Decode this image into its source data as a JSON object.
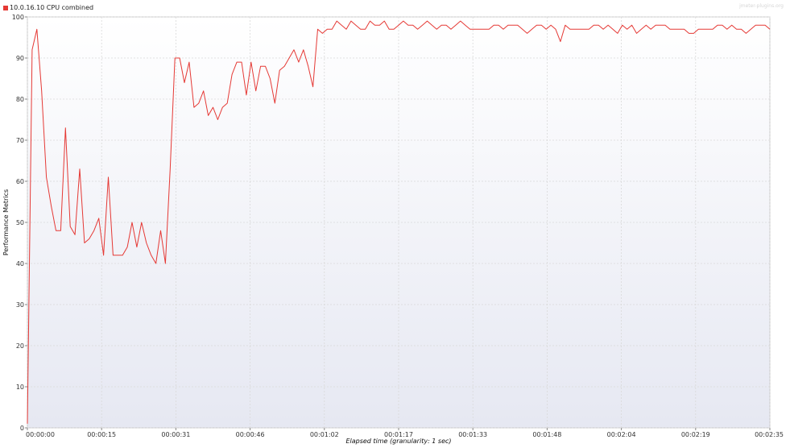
{
  "legend": {
    "label": "10.0.16.10 CPU combined",
    "color": "#e53935"
  },
  "watermark": "jmeter-plugins.org",
  "chart_data": {
    "type": "line",
    "title": "",
    "xlabel": "Elapsed time (granularity: 1 sec)",
    "ylabel": "Performance Metrics",
    "ylim": [
      0,
      100
    ],
    "xlim": [
      0,
      155
    ],
    "grid": true,
    "legend_position": "top-left",
    "y_ticks": [
      0,
      10,
      20,
      30,
      40,
      50,
      60,
      70,
      80,
      90,
      100
    ],
    "x_ticks": [
      {
        "t": 0,
        "label": "00:00:00"
      },
      {
        "t": 15.5,
        "label": "00:00:15"
      },
      {
        "t": 31,
        "label": "00:00:31"
      },
      {
        "t": 46.5,
        "label": "00:00:46"
      },
      {
        "t": 62,
        "label": "00:01:02"
      },
      {
        "t": 77.5,
        "label": "00:01:17"
      },
      {
        "t": 93,
        "label": "00:01:33"
      },
      {
        "t": 108.5,
        "label": "00:01:48"
      },
      {
        "t": 124,
        "label": "00:02:04"
      },
      {
        "t": 139.5,
        "label": "00:02:19"
      },
      {
        "t": 155,
        "label": "00:02:35"
      }
    ],
    "series": [
      {
        "name": "10.0.16.10 CPU combined",
        "color": "#e53935",
        "values": [
          1,
          92,
          97,
          82,
          61,
          54,
          48,
          48,
          73,
          49,
          47,
          63,
          45,
          46,
          48,
          51,
          42,
          61,
          42,
          42,
          42,
          44,
          50,
          44,
          50,
          45,
          42,
          40,
          48,
          40,
          63,
          90,
          90,
          84,
          89,
          78,
          79,
          82,
          76,
          78,
          75,
          78,
          79,
          86,
          89,
          89,
          81,
          89,
          82,
          88,
          88,
          85,
          79,
          87,
          88,
          90,
          92,
          89,
          92,
          88,
          83,
          97,
          96,
          97,
          97,
          99,
          98,
          97,
          99,
          98,
          97,
          97,
          99,
          98,
          98,
          99,
          97,
          97,
          98,
          99,
          98,
          98,
          97,
          98,
          99,
          98,
          97,
          98,
          98,
          97,
          98,
          99,
          98,
          97,
          97,
          97,
          97,
          97,
          98,
          98,
          97,
          98,
          98,
          98,
          97,
          96,
          97,
          98,
          98,
          97,
          98,
          97,
          94,
          98,
          97,
          97,
          97,
          97,
          97,
          98,
          98,
          97,
          98,
          97,
          96,
          98,
          97,
          98,
          96,
          97,
          98,
          97,
          98,
          98,
          98,
          97,
          97,
          97,
          97,
          96,
          96,
          97,
          97,
          97,
          97,
          98,
          98,
          97,
          98,
          97,
          97,
          96,
          97,
          98,
          98,
          98,
          97
        ]
      }
    ]
  }
}
